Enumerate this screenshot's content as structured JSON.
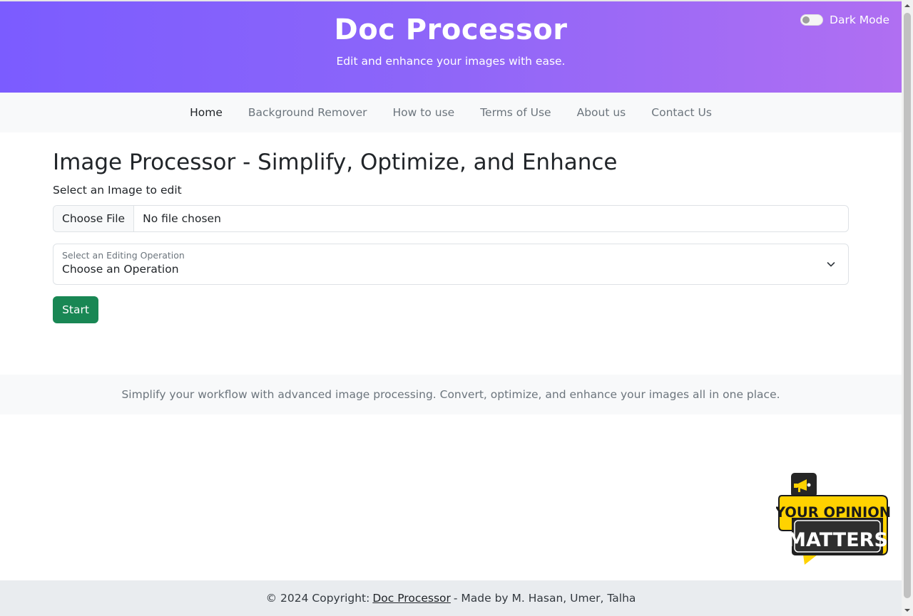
{
  "header": {
    "title": "Doc Processor",
    "subtitle": "Edit and enhance your images with ease.",
    "dark_mode_label": "Dark Mode",
    "dark_mode_on": false
  },
  "nav": {
    "items": [
      {
        "label": "Home",
        "active": true
      },
      {
        "label": "Background Remover"
      },
      {
        "label": "How to use"
      },
      {
        "label": "Terms of Use"
      },
      {
        "label": "About us"
      },
      {
        "label": "Contact Us"
      }
    ]
  },
  "main": {
    "title": "Image Processor - Simplify, Optimize, and Enhance",
    "select_image_label": "Select an Image to edit",
    "file_button_label": "Choose File",
    "file_status": "No file chosen",
    "operation": {
      "label": "Select an Editing Operation",
      "value": "Choose an Operation"
    },
    "start_label": "Start"
  },
  "info_band": {
    "text": "Simplify your workflow with advanced image processing. Convert, optimize, and enhance your images all in one place."
  },
  "feedback_badge": {
    "line1": "YOUR OPINION",
    "line2": "MATTERS",
    "icon": "megaphone-icon"
  },
  "footer": {
    "prefix": "© 2024 Copyright:",
    "link": "Doc Processor",
    "suffix": "- Made by M. Hasan, Umer, Talha"
  },
  "colors": {
    "header_gradient_start": "#7b5cff",
    "header_gradient_end": "#b06ff2",
    "start_button": "#198754",
    "badge_yellow": "#ffd200",
    "badge_dark": "#1a1a1a"
  }
}
